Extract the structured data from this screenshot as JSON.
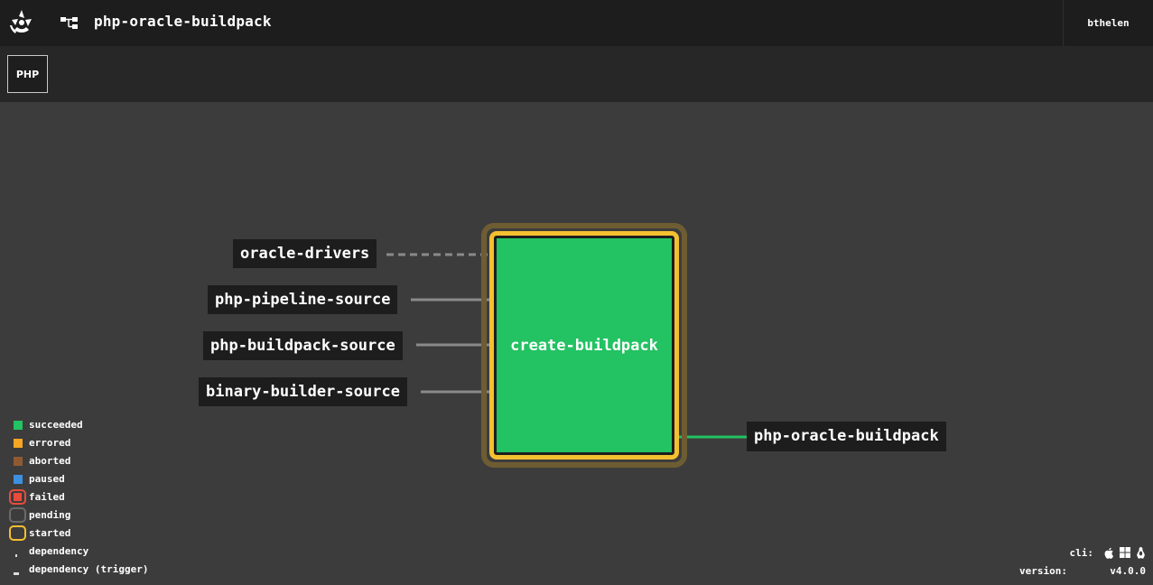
{
  "header": {
    "pipeline_name": "php-oracle-buildpack",
    "user": "bthelen"
  },
  "groups": [
    {
      "label": "PHP"
    }
  ],
  "graph": {
    "inputs": [
      {
        "name": "oracle-drivers",
        "connection": "dependency"
      },
      {
        "name": "php-pipeline-source",
        "connection": "trigger"
      },
      {
        "name": "php-buildpack-source",
        "connection": "trigger"
      },
      {
        "name": "binary-builder-source",
        "connection": "trigger"
      }
    ],
    "job": {
      "name": "create-buildpack",
      "status": "succeeded",
      "running": "started"
    },
    "outputs": [
      {
        "name": "php-oracle-buildpack"
      }
    ]
  },
  "legend": {
    "succeeded": "succeeded",
    "errored": "errored",
    "aborted": "aborted",
    "paused": "paused",
    "failed": "failed",
    "pending": "pending",
    "started": "started",
    "dependency": "dependency",
    "dependency_trigger": "dependency (trigger)"
  },
  "footer": {
    "cli_label": "cli:",
    "cli_icons": [
      "apple-icon",
      "windows-icon",
      "linux-icon"
    ],
    "version_label": "version:",
    "version_value": "v4.0.0"
  },
  "colors": {
    "succeeded": "#23c262",
    "errored": "#f5a623",
    "aborted": "#8f5a32",
    "paused": "#3d8fe0",
    "failed": "#e74c3c",
    "pending": "#6b6b6b",
    "started": "#f5c030"
  }
}
